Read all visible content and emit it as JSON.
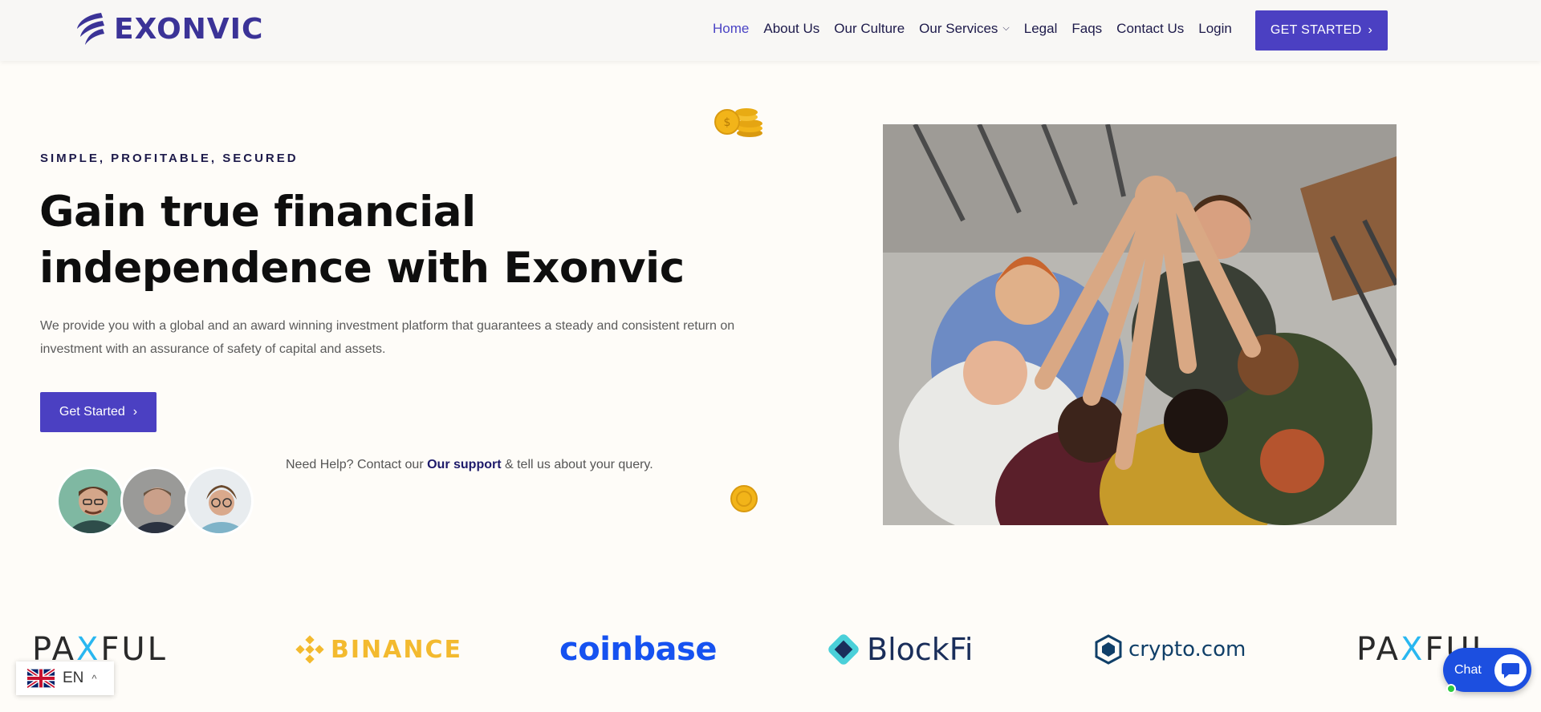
{
  "brand": {
    "name": "EXONVIC",
    "color": "#3b3397"
  },
  "nav": {
    "items": [
      {
        "label": "Home",
        "active": true
      },
      {
        "label": "About Us"
      },
      {
        "label": "Our Culture"
      },
      {
        "label": "Our Services",
        "has_dropdown": true
      },
      {
        "label": "Legal"
      },
      {
        "label": "Faqs"
      },
      {
        "label": "Contact Us"
      },
      {
        "label": "Login"
      }
    ],
    "cta_label": "GET STARTED"
  },
  "hero": {
    "eyebrow": "SIMPLE, PROFITABLE, SECURED",
    "title": "Gain true financial independence with Exonvic",
    "description": "We provide you with a global and an award winning investment platform that guarantees a steady and consistent return on investment with an assurance of safety of capital and assets.",
    "button_label": "Get Started",
    "help_prefix": "Need Help? Contact our ",
    "help_link": "Our support",
    "help_suffix": " & tell us about your query."
  },
  "partners": [
    "PAXFUL",
    "BINANCE",
    "coinbase",
    "BlockFi",
    "crypto.com",
    "PAXFUL"
  ],
  "language": {
    "code": "EN"
  },
  "chat": {
    "label": "Chat"
  },
  "colors": {
    "accent": "#4b40c2",
    "text_dark": "#0e0e0e",
    "nav_text": "#1d1a4a",
    "chat_blue": "#1c4fe0"
  }
}
